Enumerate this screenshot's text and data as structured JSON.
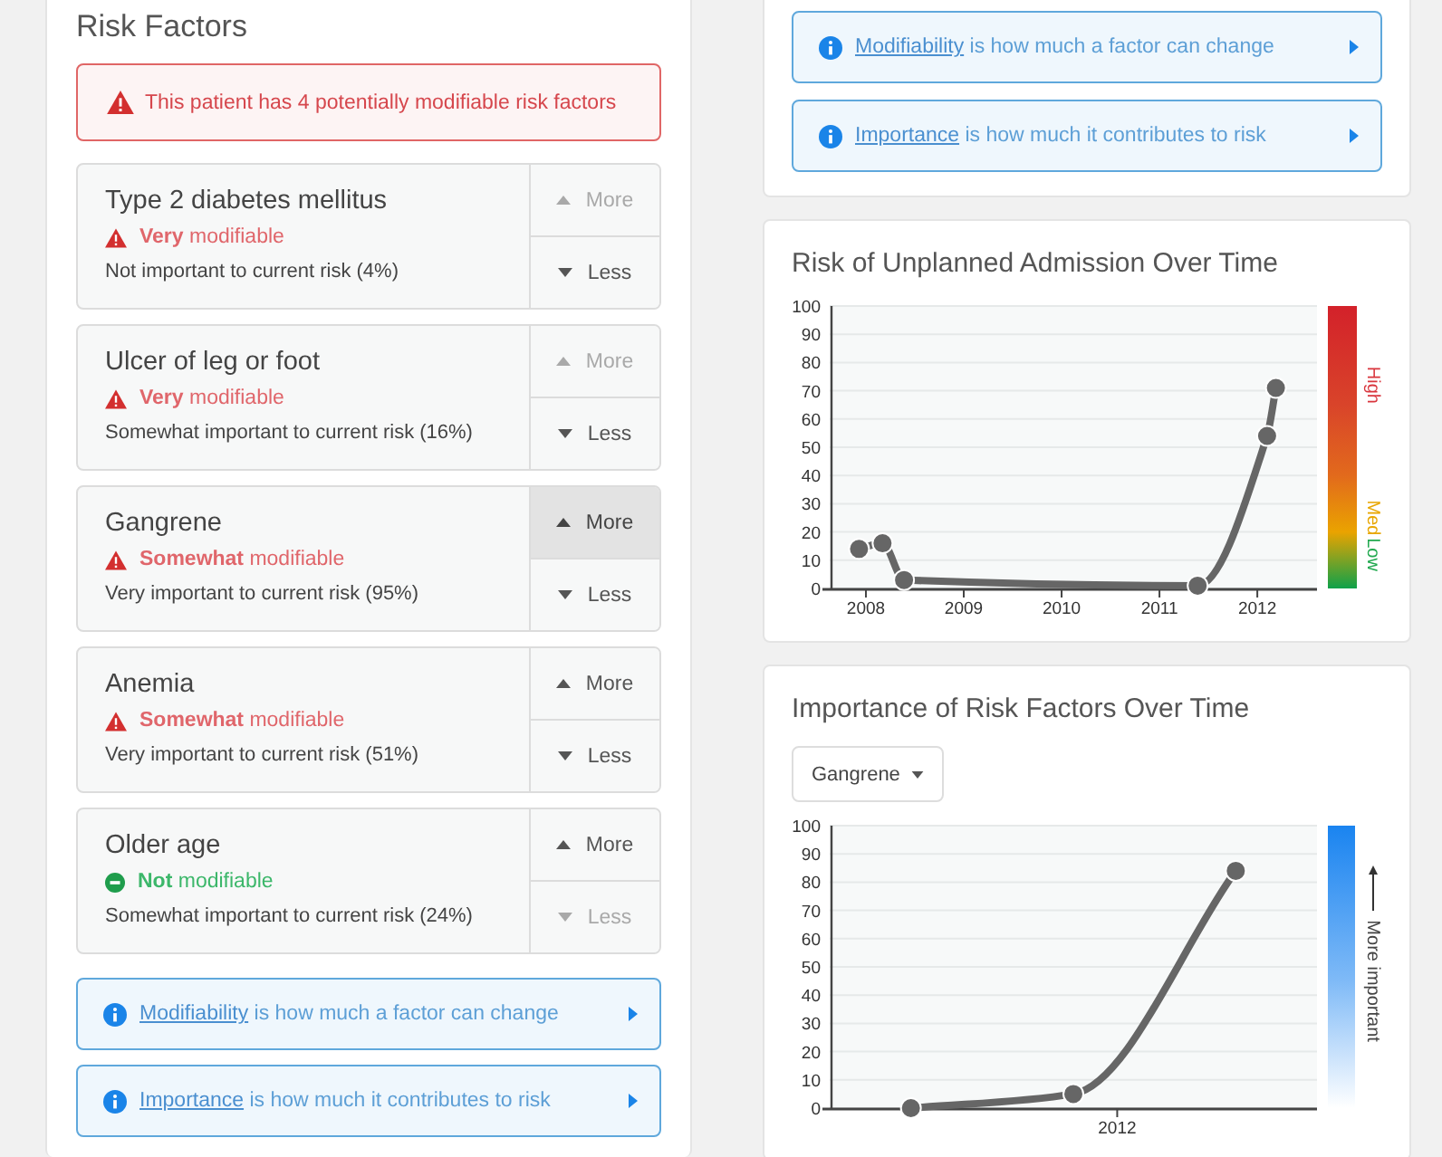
{
  "risk_factors": {
    "title": "Risk Factors",
    "alert": "This patient has 4 potentially modifiable risk factors",
    "factors": [
      {
        "name": "Type 2 diabetes mellitus",
        "modifiability": {
          "kind": "warning",
          "text": "**Very** modifiable"
        },
        "importance": "Not important to current risk (4%)",
        "more": {
          "label": "More",
          "disabled": true,
          "active": false
        },
        "less": {
          "label": "Less",
          "disabled": false
        }
      },
      {
        "name": "Ulcer of leg or foot",
        "modifiability": {
          "kind": "warning",
          "text": "**Very** modifiable"
        },
        "importance": "Somewhat important to current risk (16%)",
        "more": {
          "label": "More",
          "disabled": true,
          "active": false
        },
        "less": {
          "label": "Less",
          "disabled": false
        }
      },
      {
        "name": "Gangrene",
        "modifiability": {
          "kind": "warning",
          "text": "**Somewhat** modifiable"
        },
        "importance": "Very important to current risk (95%)",
        "more": {
          "label": "More",
          "disabled": false,
          "active": true
        },
        "less": {
          "label": "Less",
          "disabled": false
        }
      },
      {
        "name": "Anemia",
        "modifiability": {
          "kind": "warning",
          "text": "**Somewhat** modifiable"
        },
        "importance": "Very important to current risk (51%)",
        "more": {
          "label": "More",
          "disabled": false,
          "active": false
        },
        "less": {
          "label": "Less",
          "disabled": false
        }
      },
      {
        "name": "Older age",
        "modifiability": {
          "kind": "ok",
          "text": "**Not** modifiable"
        },
        "importance": "Somewhat important to current risk (24%)",
        "more": {
          "label": "More",
          "disabled": false,
          "active": false
        },
        "less": {
          "label": "Less",
          "disabled": true
        }
      }
    ],
    "info": [
      {
        "link": "Modifiability",
        "text": "is how much a factor can change"
      },
      {
        "link": "Importance",
        "text": "is how much it contributes to risk"
      }
    ]
  },
  "info_panel": {
    "info": [
      {
        "link": "Modifiability",
        "text": "is how much a factor can change"
      },
      {
        "link": "Importance",
        "text": "is how much it contributes to risk"
      }
    ]
  },
  "risk_chart": {
    "title": "Risk of Unplanned Admission Over Time",
    "chart_data": {
      "type": "line",
      "x": [
        2007.93,
        2008.17,
        2008.39,
        2011.39,
        2012.1,
        2012.19
      ],
      "series": [
        {
          "color": "#666666",
          "marker": "circle",
          "values": [
            14,
            16,
            3,
            1,
            54,
            71
          ]
        }
      ],
      "xlim": [
        2007.63,
        2012.61
      ],
      "ylim": [
        0,
        100
      ],
      "xticks": [
        2008,
        2009,
        2010,
        2011,
        2012
      ],
      "yticks": [
        0,
        10,
        20,
        30,
        40,
        50,
        60,
        70,
        80,
        90,
        100
      ],
      "grid": true
    },
    "scale_labels": [
      {
        "text": "High",
        "color": "#d9363e"
      },
      {
        "text": "Med",
        "color": "#e8a600"
      },
      {
        "text": "Low",
        "color": "#22a94f"
      }
    ]
  },
  "importance_chart": {
    "title": "Importance of Risk Factors Over Time",
    "dropdown": "Gangrene",
    "chart_data": {
      "type": "line",
      "series": [
        {
          "color": "#666666",
          "marker": "circle",
          "values": [
            0,
            5,
            84
          ]
        }
      ],
      "ylim": [
        0,
        100
      ],
      "yticks": [
        0,
        10,
        20,
        30,
        40,
        50,
        60,
        70,
        80,
        90,
        100
      ],
      "grid": true,
      "annotations": [
        "2012"
      ]
    },
    "scale_label": "More important"
  }
}
